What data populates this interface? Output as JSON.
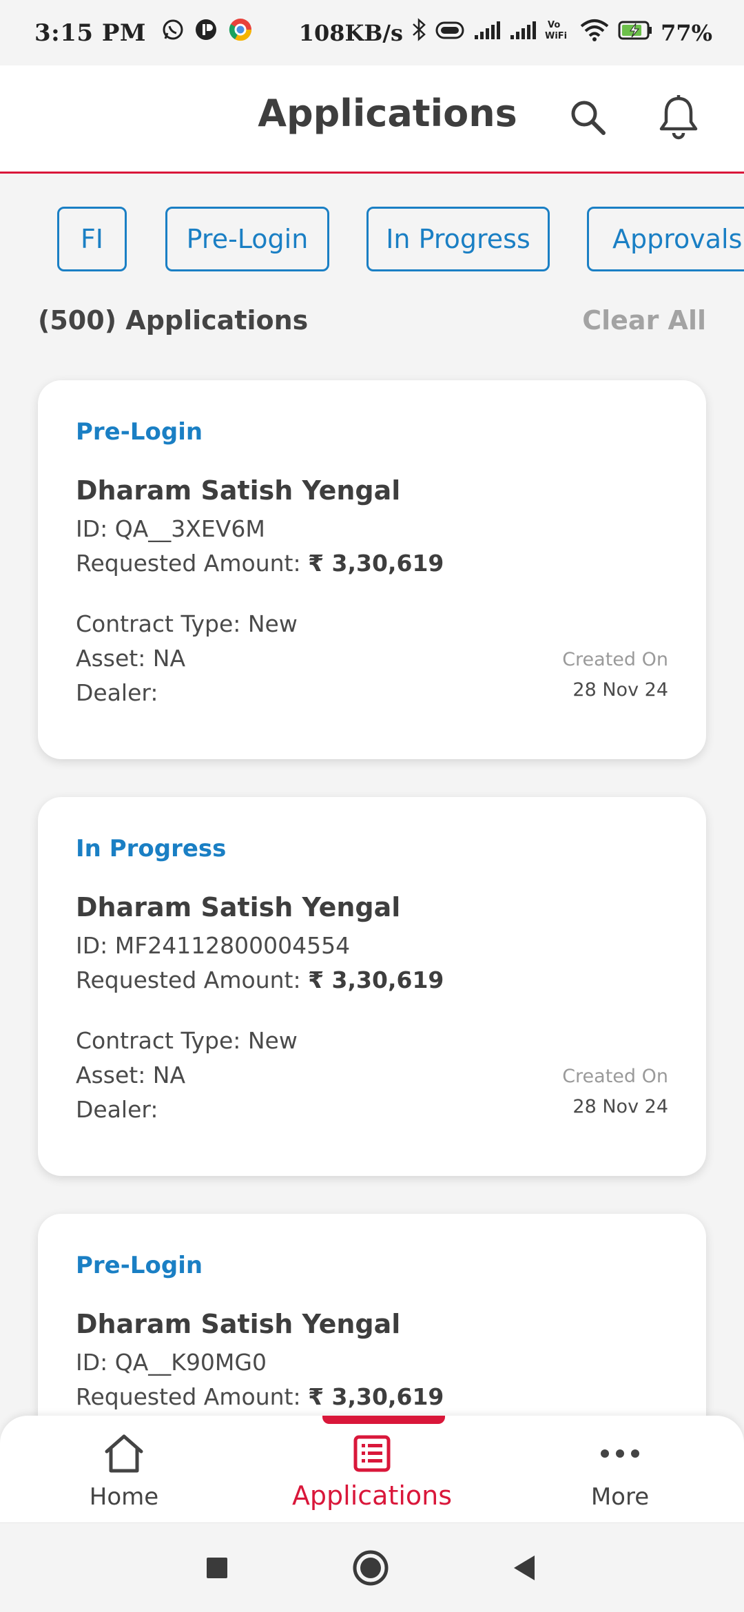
{
  "status_bar": {
    "time": "3:15 PM",
    "network_speed": "108KB/s",
    "battery": "77%",
    "icons": [
      "whatsapp-icon",
      "app-icon",
      "chrome-icon",
      "bluetooth-icon",
      "vibrate-icon",
      "signal-icon",
      "signal-icon",
      "vowifi-icon",
      "wifi-icon",
      "battery-charging-icon"
    ],
    "vowifi_label": "Vo WiFi"
  },
  "header": {
    "title": "Applications",
    "icons": [
      "search-icon",
      "bell-icon"
    ]
  },
  "filters": {
    "chips": [
      "FI",
      "Pre-Login",
      "In Progress",
      "Approvals"
    ]
  },
  "summary": {
    "count_label": "(500) Applications",
    "clear_all": "Clear All"
  },
  "applications": [
    {
      "status": "Pre-Login",
      "name": "Dharam Satish Yengal",
      "id": "ID: QA__3XEV6M",
      "amount_label": "Requested Amount: ",
      "amount": "₹ 3,30,619",
      "contract": "Contract Type: New",
      "asset": "Asset: NA",
      "dealer": "Dealer:",
      "created_label": "Created On",
      "created_date": "28 Nov 24"
    },
    {
      "status": "In Progress",
      "name": "Dharam Satish Yengal",
      "id": "ID: MF24112800004554",
      "amount_label": "Requested Amount: ",
      "amount": "₹ 3,30,619",
      "contract": "Contract Type: New",
      "asset": "Asset: NA",
      "dealer": "Dealer:",
      "created_label": "Created On",
      "created_date": "28 Nov 24"
    },
    {
      "status": "Pre-Login",
      "name": "Dharam Satish Yengal",
      "id": "ID: QA__K90MG0",
      "amount_label": "Requested Amount: ",
      "amount": "₹ 3,30,619"
    }
  ],
  "bottom_nav": {
    "items": [
      {
        "label": "Home",
        "icon": "home-icon"
      },
      {
        "label": "Applications",
        "icon": "applications-icon",
        "active": true
      },
      {
        "label": "More",
        "icon": "more-icon"
      }
    ]
  },
  "system_nav": {
    "icons": [
      "recent-apps-icon",
      "home-circle-icon",
      "back-icon"
    ]
  },
  "colors": {
    "accent": "#d9173a",
    "link_blue": "#1a7fc4",
    "background": "#f4f4f4",
    "muted": "#a3a3a3"
  }
}
